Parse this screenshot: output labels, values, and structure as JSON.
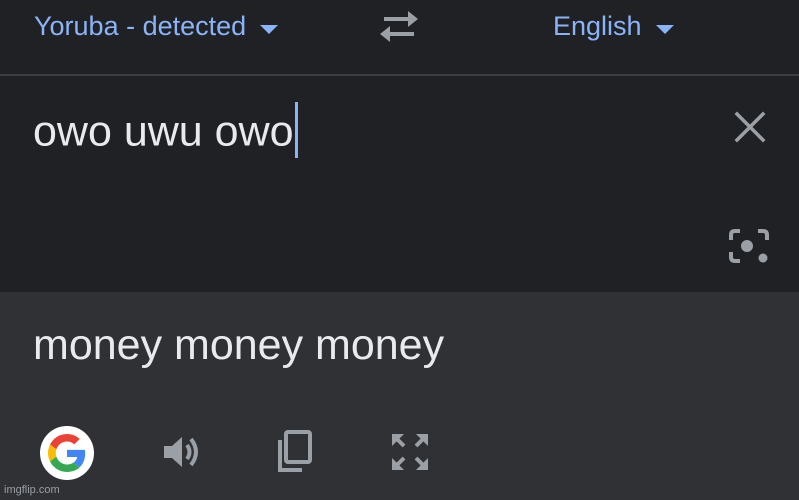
{
  "language_bar": {
    "source_language": "Yoruba - detected",
    "target_language": "English",
    "swap_icon": "swap-arrows-icon"
  },
  "source": {
    "text": "owo uwu owo",
    "clear_icon": "close-icon",
    "camera_icon": "camera-lens-icon"
  },
  "result": {
    "text": "money money money",
    "actions": [
      {
        "icon": "google-logo-icon"
      },
      {
        "icon": "speaker-icon"
      },
      {
        "icon": "copy-icon"
      },
      {
        "icon": "fullscreen-icon"
      }
    ]
  },
  "watermark": "imgflip.com",
  "colors": {
    "accent": "#8ab4f8",
    "background": "#202124",
    "result_background": "#303134",
    "text": "#e8eaed",
    "icon": "#9aa0a6"
  }
}
